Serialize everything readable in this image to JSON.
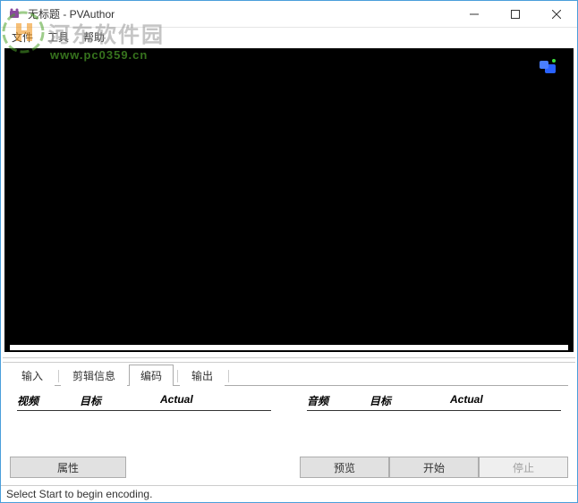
{
  "window": {
    "title": "无标题 - PVAuthor"
  },
  "menubar": {
    "file": "文件",
    "tools": "工具",
    "help": "帮助"
  },
  "watermark": {
    "text": "河东软件园",
    "url": "www.pc0359.cn"
  },
  "tabs": {
    "input": "输入",
    "crop": "剪辑信息",
    "encode": "编码",
    "output": "输出"
  },
  "columns": {
    "video": "视频",
    "audio": "音频",
    "target": "目标",
    "actual": "Actual"
  },
  "buttons": {
    "properties": "属性",
    "preview": "预览",
    "start": "开始",
    "stop": "停止"
  },
  "statusbar": {
    "text": "Select Start to begin encoding."
  }
}
